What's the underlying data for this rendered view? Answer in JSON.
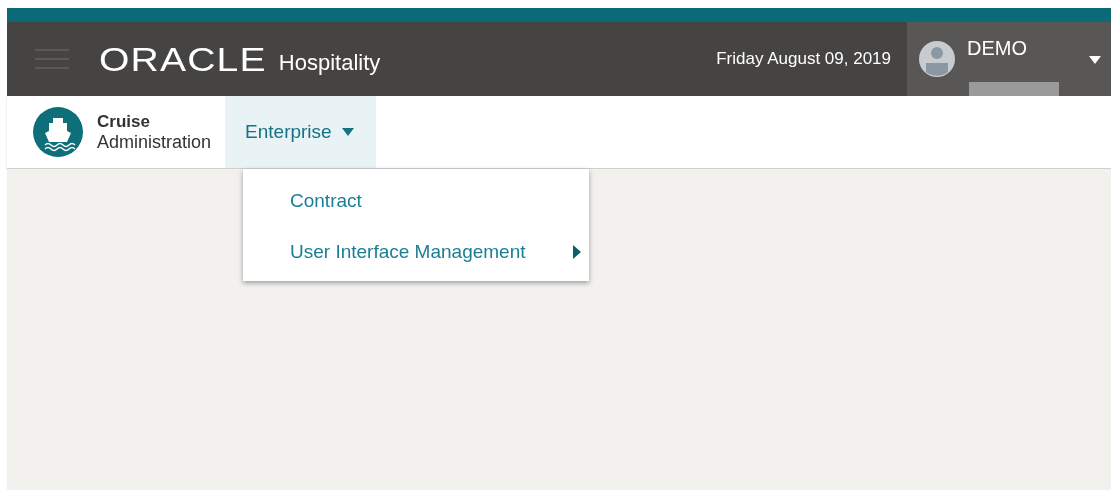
{
  "header": {
    "brand": "ORACLE",
    "product": "Hospitality",
    "date": "Friday August 09, 2019",
    "user": {
      "name": "DEMO",
      "detail_redacted": true
    }
  },
  "app": {
    "title": "Cruise",
    "subtitle": "Administration"
  },
  "nav": [
    {
      "label": "Enterprise",
      "selected": true,
      "expanded": true
    }
  ],
  "menu": [
    {
      "label": "Contract",
      "has_submenu": false
    },
    {
      "label": "User Interface Management",
      "has_submenu": true
    }
  ]
}
